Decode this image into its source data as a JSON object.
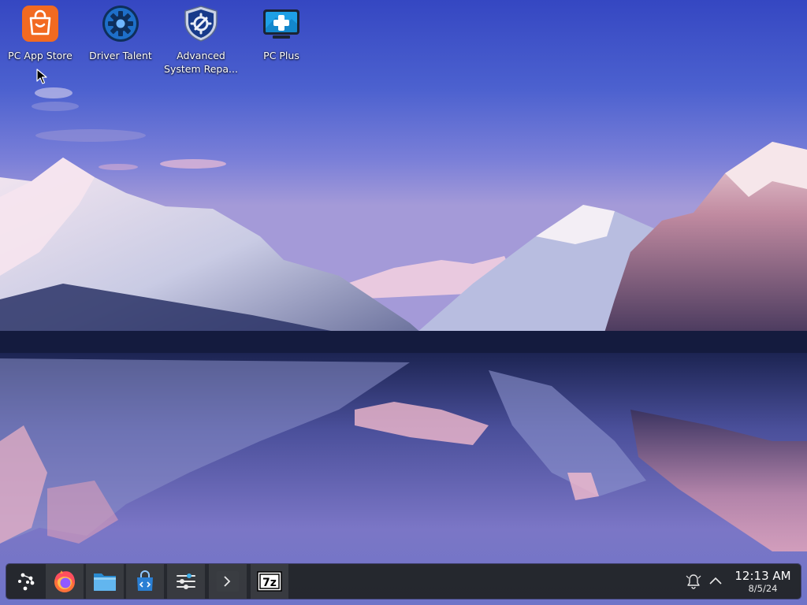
{
  "desktop": {
    "icons": [
      {
        "label": "PC App Store",
        "icon": "shopping-bag-icon"
      },
      {
        "label": "Driver Talent",
        "icon": "gear-icon"
      },
      {
        "label": "Advanced System Repa...",
        "icon": "shield-gear-icon"
      },
      {
        "label": "PC Plus",
        "icon": "monitor-plus-icon"
      }
    ]
  },
  "taskbar": {
    "apps": [
      {
        "icon": "app-launcher-icon"
      },
      {
        "icon": "firefox-icon"
      },
      {
        "icon": "file-manager-icon"
      },
      {
        "icon": "discover-store-icon"
      },
      {
        "icon": "system-settings-icon"
      },
      {
        "icon": "terminal-icon"
      },
      {
        "icon": "7zip-icon",
        "text": "7z"
      }
    ],
    "tray": {
      "notifications_icon": "bell-icon",
      "expand_icon": "chevron-up-icon"
    },
    "clock": {
      "time": "12:13 AM",
      "date": "8/5/24"
    }
  },
  "colors": {
    "sky_top": "#3a4fc4",
    "taskbar_bg": "#222428",
    "app_store_orange": "#f26a21",
    "driver_talent_blue": "#1e6fc9"
  }
}
